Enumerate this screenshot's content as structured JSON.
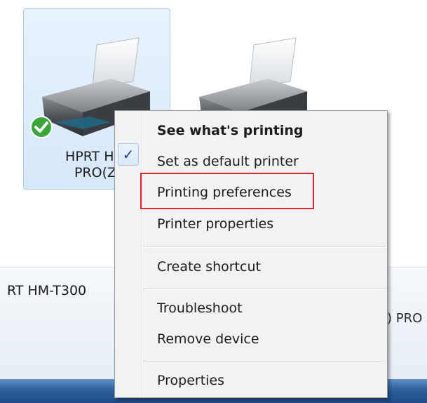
{
  "devices": [
    {
      "label_line1": "HPRT HM",
      "label_line2": "PRO(Z",
      "status_icon": "default-check-icon"
    },
    {
      "label_line1": "",
      "label_line2": ""
    }
  ],
  "details": {
    "device_name": "RT HM-T300",
    "device_name_right": ") PRO"
  },
  "context_menu": {
    "check_mark": "✓",
    "items": [
      {
        "label": "See what's printing"
      },
      {
        "label": "Set as default printer"
      },
      {
        "label": "Printing preferences"
      },
      {
        "label": "Printer properties"
      },
      {
        "label": "Create shortcut"
      },
      {
        "label": "Troubleshoot"
      },
      {
        "label": "Remove device"
      },
      {
        "label": "Properties"
      }
    ]
  },
  "highlight_color": "#e3232d"
}
